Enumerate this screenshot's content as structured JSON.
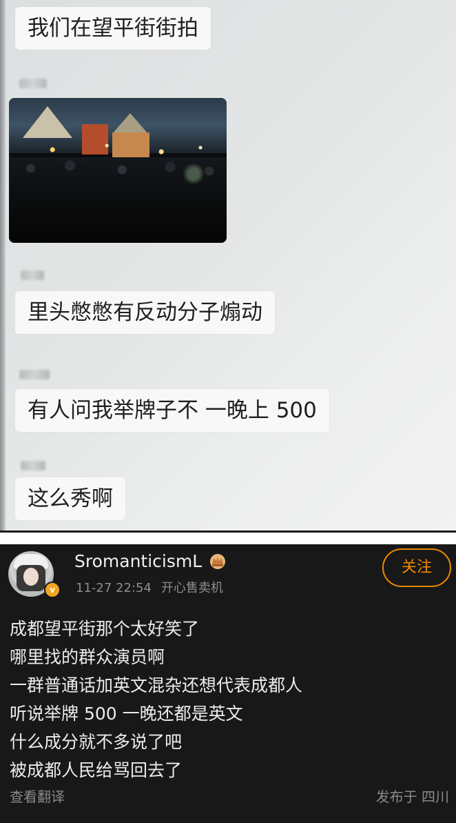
{
  "chat": {
    "messages": [
      "我们在望平街街拍",
      "里头憋憋有反动分子煽动",
      "有人问我举牌子不  一晚上 500",
      "这么秀啊"
    ]
  },
  "post": {
    "username": "SromanticismL",
    "timestamp": "11-27 22:54",
    "source": "开心售卖机",
    "follow_label": "关注",
    "lines": [
      "成都望平街那个太好笑了",
      "哪里找的群众演员啊",
      "一群普通话加英文混杂还想代表成都人",
      "听说举牌 500 一晚还都是英文",
      "什么成分就不多说了吧",
      "被成都人民给骂回去了"
    ],
    "translate_label": "查看翻译",
    "location": "发布于 四川",
    "verified_badge": "v"
  },
  "colors": {
    "post_background": "#181818",
    "follow_accent": "#f08a00",
    "verified_badge": "#f0a522",
    "chat_bubble": "#f7f8f7"
  }
}
